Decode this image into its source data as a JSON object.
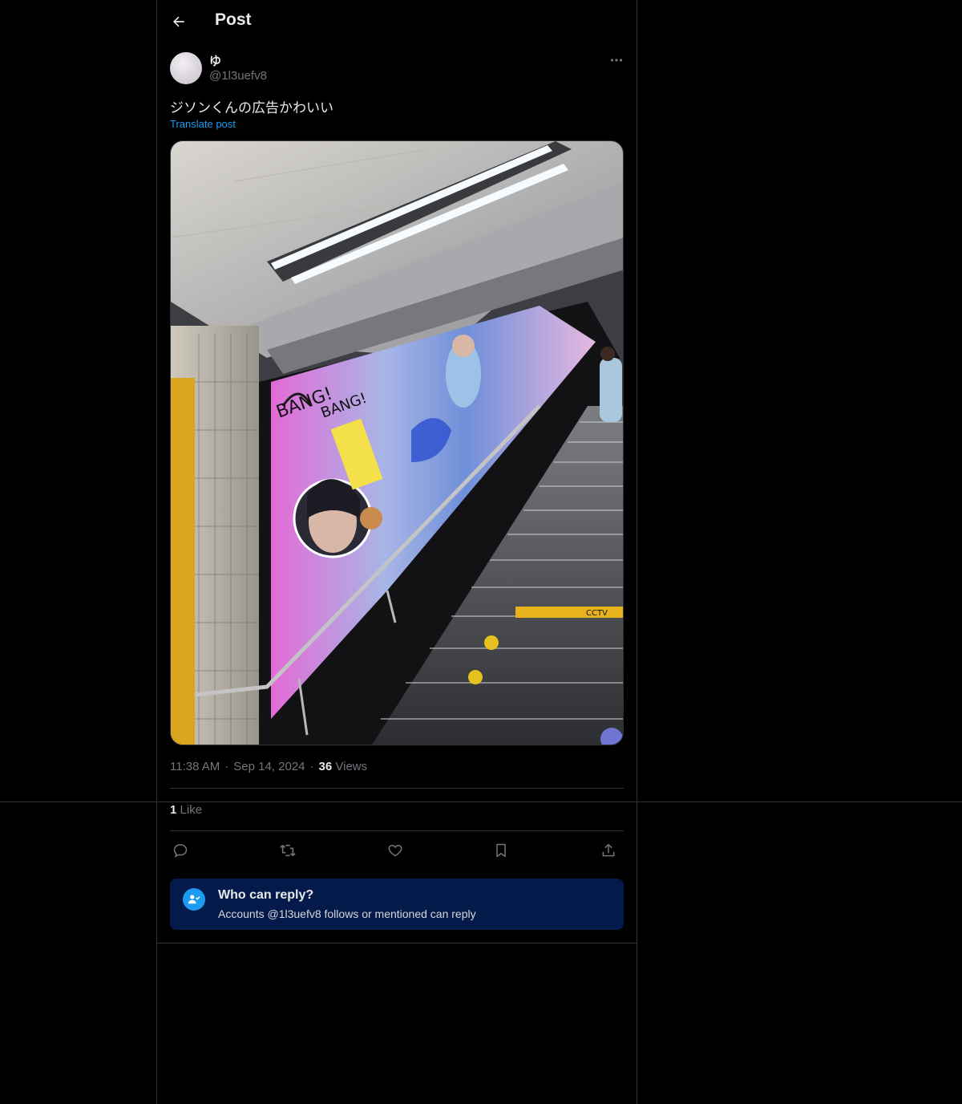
{
  "header": {
    "title": "Post"
  },
  "post": {
    "author": {
      "display_name": "ゆ",
      "handle": "@1l3uefv8"
    },
    "text": "ジソンくんの広告かわいい",
    "translate_label": "Translate post",
    "time": "11:38 AM",
    "separator": "·",
    "date": "Sep 14, 2024",
    "views_count": "36",
    "views_label": "Views",
    "likes_count": "1",
    "likes_label": "Like"
  },
  "media": {
    "banner_text": [
      "BANG!",
      "BANG!",
      "CCTV"
    ]
  },
  "actions": [
    "reply-icon",
    "repost-icon",
    "like-icon",
    "bookmark-icon",
    "share-icon"
  ],
  "reply_settings": {
    "title": "Who can reply?",
    "subtitle": "Accounts @1l3uefv8 follows or mentioned can reply"
  },
  "colors": {
    "accent": "#1d9bf0",
    "background": "#000000",
    "border": "#2f3336",
    "muted": "#71767b",
    "reply_box": "#031a4a"
  }
}
